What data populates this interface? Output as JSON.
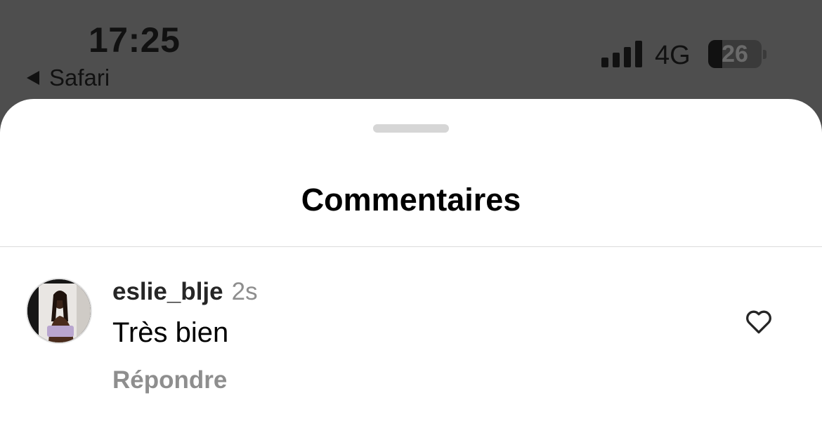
{
  "status_bar": {
    "time": "17:25",
    "back_app": "Safari",
    "network": "4G",
    "battery": "26",
    "battery_level": 0.26
  },
  "sheet": {
    "title": "Commentaires"
  },
  "comment": {
    "username": "eslie_blje",
    "timestamp": "2s",
    "text": "Très bien",
    "reply_label": "Répondre",
    "like_icon": "heart-outline-icon"
  },
  "colors": {
    "status_bar_bg": "#4e4e4e",
    "sheet_bg": "#ffffff",
    "secondary_text": "#8e8e8e"
  }
}
